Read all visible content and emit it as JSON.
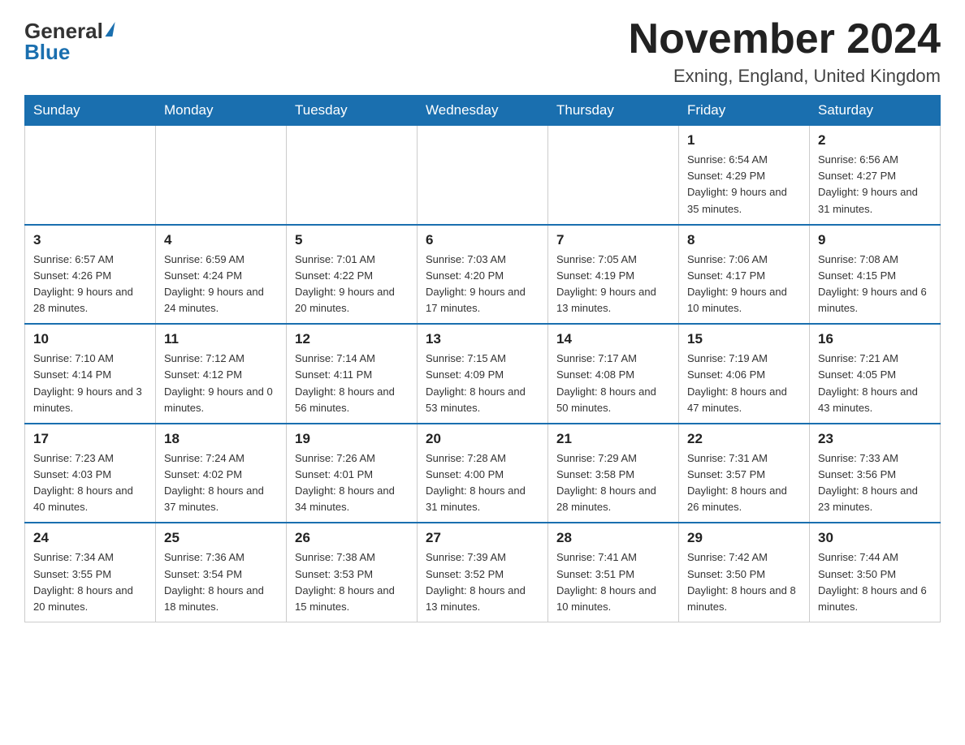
{
  "header": {
    "logo_general": "General",
    "logo_blue": "Blue",
    "month_title": "November 2024",
    "location": "Exning, England, United Kingdom"
  },
  "weekdays": [
    "Sunday",
    "Monday",
    "Tuesday",
    "Wednesday",
    "Thursday",
    "Friday",
    "Saturday"
  ],
  "weeks": [
    [
      {
        "day": "",
        "info": ""
      },
      {
        "day": "",
        "info": ""
      },
      {
        "day": "",
        "info": ""
      },
      {
        "day": "",
        "info": ""
      },
      {
        "day": "",
        "info": ""
      },
      {
        "day": "1",
        "info": "Sunrise: 6:54 AM\nSunset: 4:29 PM\nDaylight: 9 hours and 35 minutes."
      },
      {
        "day": "2",
        "info": "Sunrise: 6:56 AM\nSunset: 4:27 PM\nDaylight: 9 hours and 31 minutes."
      }
    ],
    [
      {
        "day": "3",
        "info": "Sunrise: 6:57 AM\nSunset: 4:26 PM\nDaylight: 9 hours and 28 minutes."
      },
      {
        "day": "4",
        "info": "Sunrise: 6:59 AM\nSunset: 4:24 PM\nDaylight: 9 hours and 24 minutes."
      },
      {
        "day": "5",
        "info": "Sunrise: 7:01 AM\nSunset: 4:22 PM\nDaylight: 9 hours and 20 minutes."
      },
      {
        "day": "6",
        "info": "Sunrise: 7:03 AM\nSunset: 4:20 PM\nDaylight: 9 hours and 17 minutes."
      },
      {
        "day": "7",
        "info": "Sunrise: 7:05 AM\nSunset: 4:19 PM\nDaylight: 9 hours and 13 minutes."
      },
      {
        "day": "8",
        "info": "Sunrise: 7:06 AM\nSunset: 4:17 PM\nDaylight: 9 hours and 10 minutes."
      },
      {
        "day": "9",
        "info": "Sunrise: 7:08 AM\nSunset: 4:15 PM\nDaylight: 9 hours and 6 minutes."
      }
    ],
    [
      {
        "day": "10",
        "info": "Sunrise: 7:10 AM\nSunset: 4:14 PM\nDaylight: 9 hours and 3 minutes."
      },
      {
        "day": "11",
        "info": "Sunrise: 7:12 AM\nSunset: 4:12 PM\nDaylight: 9 hours and 0 minutes."
      },
      {
        "day": "12",
        "info": "Sunrise: 7:14 AM\nSunset: 4:11 PM\nDaylight: 8 hours and 56 minutes."
      },
      {
        "day": "13",
        "info": "Sunrise: 7:15 AM\nSunset: 4:09 PM\nDaylight: 8 hours and 53 minutes."
      },
      {
        "day": "14",
        "info": "Sunrise: 7:17 AM\nSunset: 4:08 PM\nDaylight: 8 hours and 50 minutes."
      },
      {
        "day": "15",
        "info": "Sunrise: 7:19 AM\nSunset: 4:06 PM\nDaylight: 8 hours and 47 minutes."
      },
      {
        "day": "16",
        "info": "Sunrise: 7:21 AM\nSunset: 4:05 PM\nDaylight: 8 hours and 43 minutes."
      }
    ],
    [
      {
        "day": "17",
        "info": "Sunrise: 7:23 AM\nSunset: 4:03 PM\nDaylight: 8 hours and 40 minutes."
      },
      {
        "day": "18",
        "info": "Sunrise: 7:24 AM\nSunset: 4:02 PM\nDaylight: 8 hours and 37 minutes."
      },
      {
        "day": "19",
        "info": "Sunrise: 7:26 AM\nSunset: 4:01 PM\nDaylight: 8 hours and 34 minutes."
      },
      {
        "day": "20",
        "info": "Sunrise: 7:28 AM\nSunset: 4:00 PM\nDaylight: 8 hours and 31 minutes."
      },
      {
        "day": "21",
        "info": "Sunrise: 7:29 AM\nSunset: 3:58 PM\nDaylight: 8 hours and 28 minutes."
      },
      {
        "day": "22",
        "info": "Sunrise: 7:31 AM\nSunset: 3:57 PM\nDaylight: 8 hours and 26 minutes."
      },
      {
        "day": "23",
        "info": "Sunrise: 7:33 AM\nSunset: 3:56 PM\nDaylight: 8 hours and 23 minutes."
      }
    ],
    [
      {
        "day": "24",
        "info": "Sunrise: 7:34 AM\nSunset: 3:55 PM\nDaylight: 8 hours and 20 minutes."
      },
      {
        "day": "25",
        "info": "Sunrise: 7:36 AM\nSunset: 3:54 PM\nDaylight: 8 hours and 18 minutes."
      },
      {
        "day": "26",
        "info": "Sunrise: 7:38 AM\nSunset: 3:53 PM\nDaylight: 8 hours and 15 minutes."
      },
      {
        "day": "27",
        "info": "Sunrise: 7:39 AM\nSunset: 3:52 PM\nDaylight: 8 hours and 13 minutes."
      },
      {
        "day": "28",
        "info": "Sunrise: 7:41 AM\nSunset: 3:51 PM\nDaylight: 8 hours and 10 minutes."
      },
      {
        "day": "29",
        "info": "Sunrise: 7:42 AM\nSunset: 3:50 PM\nDaylight: 8 hours and 8 minutes."
      },
      {
        "day": "30",
        "info": "Sunrise: 7:44 AM\nSunset: 3:50 PM\nDaylight: 8 hours and 6 minutes."
      }
    ]
  ]
}
